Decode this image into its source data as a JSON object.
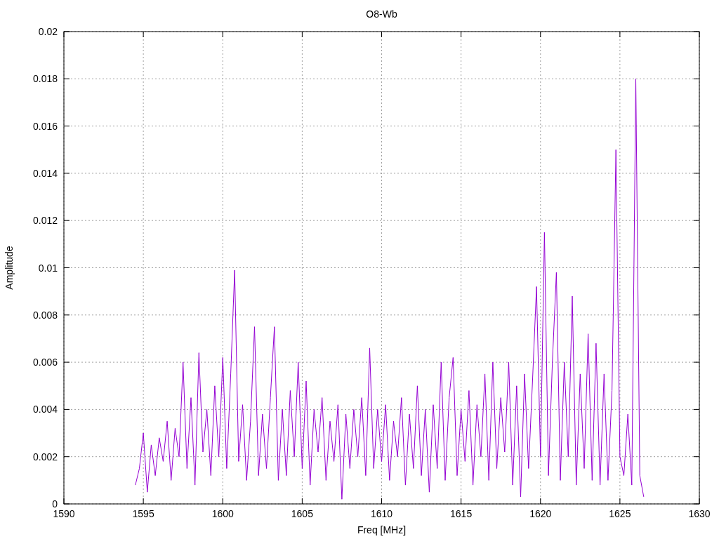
{
  "chart_data": {
    "type": "line",
    "title": "O8-Wb",
    "xlabel": "Freq [MHz]",
    "ylabel": "Amplitude",
    "grid": true,
    "xlim": [
      1590,
      1630
    ],
    "ylim": [
      0,
      0.02
    ],
    "xticks": [
      1590,
      1595,
      1600,
      1605,
      1610,
      1615,
      1620,
      1625,
      1630
    ],
    "yticks": [
      0,
      0.002,
      0.004,
      0.006,
      0.008,
      0.01,
      0.012,
      0.014,
      0.016,
      0.018,
      0.02
    ],
    "x": [
      1594.5,
      1594.75,
      1595,
      1595.25,
      1595.5,
      1595.75,
      1596,
      1596.25,
      1596.5,
      1596.75,
      1597,
      1597.25,
      1597.5,
      1597.75,
      1598,
      1598.25,
      1598.5,
      1598.75,
      1599,
      1599.25,
      1599.5,
      1599.75,
      1600,
      1600.25,
      1600.5,
      1600.75,
      1601,
      1601.25,
      1601.5,
      1601.75,
      1602,
      1602.25,
      1602.5,
      1602.75,
      1603,
      1603.25,
      1603.5,
      1603.75,
      1604,
      1604.25,
      1604.5,
      1604.75,
      1605,
      1605.25,
      1605.5,
      1605.75,
      1606,
      1606.25,
      1606.5,
      1606.75,
      1607,
      1607.25,
      1607.5,
      1607.75,
      1608,
      1608.25,
      1608.5,
      1608.75,
      1609,
      1609.25,
      1609.5,
      1609.75,
      1610,
      1610.25,
      1610.5,
      1610.75,
      1611,
      1611.25,
      1611.5,
      1611.75,
      1612,
      1612.25,
      1612.5,
      1612.75,
      1613,
      1613.25,
      1613.5,
      1613.75,
      1614,
      1614.25,
      1614.5,
      1614.75,
      1615,
      1615.25,
      1615.5,
      1615.75,
      1616,
      1616.25,
      1616.5,
      1616.75,
      1617,
      1617.25,
      1617.5,
      1617.75,
      1618,
      1618.25,
      1618.5,
      1618.75,
      1619,
      1619.25,
      1619.5,
      1619.75,
      1620,
      1620.25,
      1620.5,
      1620.75,
      1621,
      1621.25,
      1621.5,
      1621.75,
      1622,
      1622.25,
      1622.5,
      1622.75,
      1623,
      1623.25,
      1623.5,
      1623.75,
      1624,
      1624.25,
      1624.5,
      1624.75,
      1625,
      1625.25,
      1625.5,
      1625.75,
      1626,
      1626.25,
      1626.5
    ],
    "series": [
      {
        "color": "#9400d3",
        "values": [
          0.0008,
          0.0015,
          0.003,
          0.0005,
          0.0025,
          0.0012,
          0.0028,
          0.0018,
          0.0035,
          0.001,
          0.0032,
          0.002,
          0.006,
          0.0015,
          0.0045,
          0.0008,
          0.0064,
          0.0022,
          0.004,
          0.0012,
          0.005,
          0.002,
          0.0062,
          0.0015,
          0.0055,
          0.0099,
          0.0018,
          0.0042,
          0.001,
          0.0035,
          0.0075,
          0.0012,
          0.0038,
          0.0015,
          0.0045,
          0.0075,
          0.001,
          0.004,
          0.0012,
          0.0048,
          0.002,
          0.006,
          0.0015,
          0.0052,
          0.0008,
          0.004,
          0.0022,
          0.0045,
          0.001,
          0.0035,
          0.0018,
          0.0042,
          0.0002,
          0.0038,
          0.0015,
          0.004,
          0.002,
          0.0045,
          0.0012,
          0.0066,
          0.0015,
          0.004,
          0.0018,
          0.0042,
          0.001,
          0.0035,
          0.002,
          0.0045,
          0.0008,
          0.0038,
          0.0015,
          0.005,
          0.0012,
          0.004,
          0.0005,
          0.0042,
          0.0015,
          0.006,
          0.001,
          0.0045,
          0.0062,
          0.0012,
          0.004,
          0.0018,
          0.0048,
          0.0008,
          0.0042,
          0.002,
          0.0055,
          0.001,
          0.006,
          0.0015,
          0.0045,
          0.0022,
          0.006,
          0.0008,
          0.005,
          0.0003,
          0.0055,
          0.0015,
          0.0052,
          0.0092,
          0.002,
          0.0115,
          0.0012,
          0.006,
          0.0098,
          0.001,
          0.006,
          0.002,
          0.0088,
          0.0008,
          0.0055,
          0.0015,
          0.0072,
          0.001,
          0.0068,
          0.0008,
          0.0055,
          0.001,
          0.0048,
          0.015,
          0.002,
          0.0012,
          0.0038,
          0.0008,
          0.018,
          0.0012,
          0.0003
        ]
      }
    ]
  }
}
